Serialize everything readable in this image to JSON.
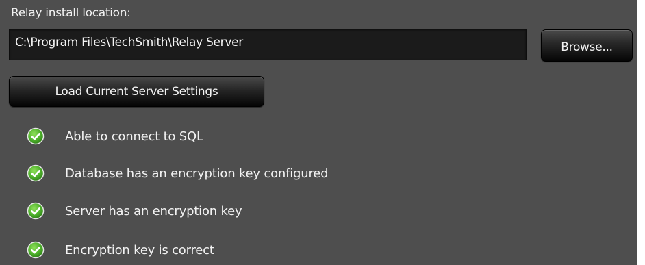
{
  "install": {
    "label": "Relay install location:",
    "path_value": "C:\\Program Files\\TechSmith\\Relay Server",
    "browse_label": "Browse..."
  },
  "load_button_label": "Load Current Server Settings",
  "checks": [
    {
      "label": "Able to connect to SQL",
      "status": "ok",
      "icon": "check-circle-icon"
    },
    {
      "label": "Database has an encryption key configured",
      "status": "ok",
      "icon": "check-circle-icon"
    },
    {
      "label": "Server has an encryption key",
      "status": "ok",
      "icon": "check-circle-icon"
    },
    {
      "label": "Encryption key is correct",
      "status": "ok",
      "icon": "check-circle-icon"
    }
  ],
  "colors": {
    "panel_background": "#4e4e4e",
    "field_background": "#1b1b1b",
    "text": "#f2f2f2",
    "check_green": "#4caf2a"
  }
}
